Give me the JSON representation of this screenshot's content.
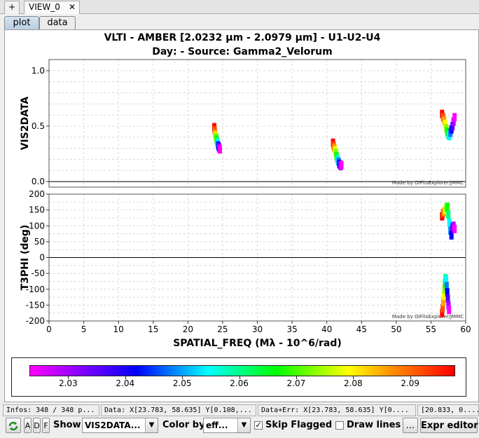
{
  "tabs": {
    "add_label": "+",
    "view_label": "VIEW_0",
    "close_label": "✕",
    "plot_label": "plot",
    "data_label": "data"
  },
  "plot_title_line1": "VLTI - AMBER [2.0232 µm - 2.0979 µm] - U1-U2-U4",
  "plot_title_line2": "Day:  - Source: Gamma2_Velorum",
  "watermark": "Made by OIFitsExplorer/JMMC",
  "chart_data": [
    {
      "type": "scatter",
      "id": "vis2",
      "ylabel": "VIS2DATA",
      "xlim": [
        0,
        60
      ],
      "ylim": [
        -0.05,
        1.1
      ],
      "yticks": [
        {
          "v": 0.0,
          "label": "0.0"
        },
        {
          "v": 0.5,
          "label": "0.5"
        },
        {
          "v": 1.0,
          "label": "1.0"
        }
      ],
      "grid": true,
      "groups": [
        {
          "x0": 23.8,
          "x1": 24.6,
          "y": [
            0.49,
            0.46,
            0.43,
            0.41,
            0.4,
            0.38,
            0.36,
            0.35,
            0.33,
            0.32,
            0.31,
            0.3,
            0.29
          ]
        },
        {
          "x0": 40.9,
          "x1": 42.1,
          "y": [
            0.35,
            0.32,
            0.3,
            0.28,
            0.26,
            0.23,
            0.21,
            0.19,
            0.18,
            0.16,
            0.15,
            0.14,
            0.15
          ]
        },
        {
          "x0": 56.6,
          "x1": 58.4,
          "y": [
            0.61,
            0.58,
            0.55,
            0.52,
            0.48,
            0.45,
            0.42,
            0.41,
            0.44,
            0.47,
            0.5,
            0.54,
            0.58
          ]
        }
      ]
    },
    {
      "type": "scatter",
      "id": "t3phi",
      "xlabel": "SPATIAL_FREQ (Mλ - 10^6/rad)",
      "ylabel": "T3PHI (deg)",
      "xlim": [
        0,
        60
      ],
      "ylim": [
        -200,
        200
      ],
      "xticks": [
        0,
        5,
        10,
        15,
        20,
        25,
        30,
        35,
        40,
        45,
        50,
        55,
        60
      ],
      "yticks": [
        -200,
        -150,
        -100,
        -50,
        0,
        50,
        100,
        150,
        200
      ],
      "grid": true,
      "groups": [
        {
          "x0": 56.6,
          "x1": 58.4,
          "y": [
            130,
            140,
            145,
            150,
            155,
            160,
            135,
            110,
            85,
            70,
            95,
            100,
            90
          ]
        },
        {
          "x0": 56.6,
          "x1": 57.6,
          "y": [
            -175,
            -160,
            -140,
            -120,
            -100,
            -80,
            -65,
            -70,
            -90,
            -110,
            -130,
            -150,
            -165
          ]
        }
      ]
    }
  ],
  "colorbar": {
    "min": 2.0232,
    "max": 2.0979,
    "ticks": [
      2.03,
      2.04,
      2.05,
      2.06,
      2.07,
      2.08,
      2.09
    ]
  },
  "status": {
    "infos": "Infos: 348 / 348 p...",
    "data": "Data: X[23.783, 58.635] Y[0.108,...",
    "data_err": "Data+Err: X[23.783, 58.635] Y[0....",
    "extra": "[20.833, 0...."
  },
  "toolbar": {
    "a_label": "A",
    "d_label": "D",
    "f_label": "F",
    "show_label": "Show",
    "show_value": "VIS2DATA...",
    "color_by_label": "Color by",
    "color_by_value": "eff...",
    "skip_flagged_label": "Skip Flagged",
    "skip_flagged_checked": "✓",
    "draw_lines_label": "Draw lines",
    "more_label": "...",
    "expr_editor_label": "Expr editor"
  },
  "colors": {
    "grid": "#d8d8d8",
    "zero_line": "#000000"
  }
}
